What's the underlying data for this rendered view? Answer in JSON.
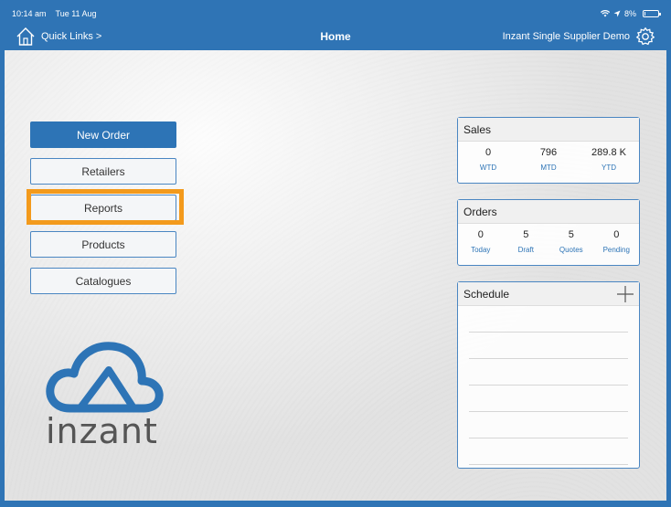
{
  "status": {
    "time": "10:14 am",
    "date": "Tue 11 Aug",
    "battery": "8%",
    "battery_level": 0.08
  },
  "nav": {
    "quick_links": "Quick Links >",
    "title": "Home",
    "account": "Inzant Single Supplier Demo"
  },
  "menu": {
    "new_order": "New Order",
    "retailers": "Retailers",
    "reports": "Reports",
    "products": "Products",
    "catalogues": "Catalogues"
  },
  "sales": {
    "title": "Sales",
    "items": [
      {
        "value": "0",
        "label": "WTD"
      },
      {
        "value": "796",
        "label": "MTD"
      },
      {
        "value": "289.8 K",
        "label": "YTD"
      }
    ]
  },
  "orders": {
    "title": "Orders",
    "items": [
      {
        "value": "0",
        "label": "Today"
      },
      {
        "value": "5",
        "label": "Draft"
      },
      {
        "value": "5",
        "label": "Quotes"
      },
      {
        "value": "0",
        "label": "Pending"
      }
    ]
  },
  "schedule": {
    "title": "Schedule"
  },
  "logo": {
    "word": "inzant"
  },
  "colors": {
    "brand": "#2f74b5",
    "highlight": "#f39a1c"
  },
  "icons": {
    "home": "home-icon",
    "settings": "gear-icon",
    "add": "plus-icon",
    "wifi": "wifi-icon",
    "location": "location-arrow-icon",
    "battery": "battery-icon"
  }
}
